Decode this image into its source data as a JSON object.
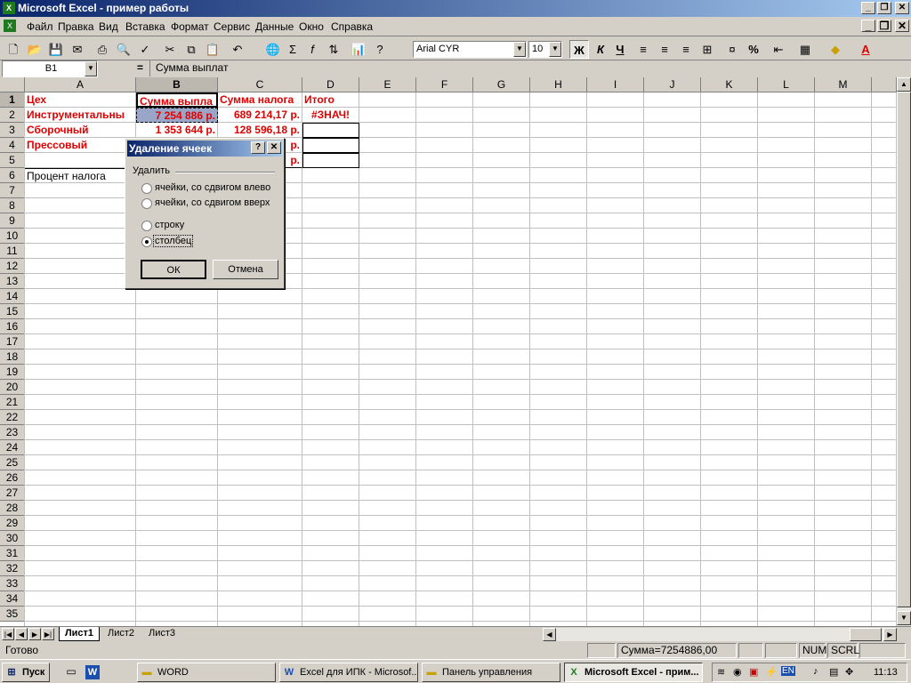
{
  "window": {
    "title": "Microsoft Excel - пример работы"
  },
  "menu": [
    "Файл",
    "Правка",
    "Вид",
    "Вставка",
    "Формат",
    "Сервис",
    "Данные",
    "Окно",
    "Справка"
  ],
  "toolbar": {
    "font": "Arial CYR",
    "size": "10",
    "bold": "Ж",
    "italic": "К",
    "underline": "Ч",
    "percent": "%"
  },
  "formula": {
    "namebox": "B1",
    "eq": "=",
    "content": "Сумма выплат"
  },
  "columns": [
    "A",
    "B",
    "C",
    "D",
    "E",
    "F",
    "G",
    "H",
    "I",
    "J",
    "K",
    "L",
    "M"
  ],
  "rows": [
    "1",
    "2",
    "3",
    "4",
    "5",
    "6",
    "7",
    "8",
    "9",
    "10",
    "11",
    "12",
    "13",
    "14",
    "15",
    "16",
    "17",
    "18",
    "19",
    "20",
    "21",
    "22",
    "23",
    "24",
    "25",
    "26",
    "27",
    "28",
    "29",
    "30",
    "31",
    "32",
    "33",
    "34",
    "35"
  ],
  "cells": {
    "a1": "Цех",
    "b1": "Сумма выпла",
    "c1": "Сумма налога",
    "d1": "Итого",
    "a2": "Инструментальны",
    "b2": "7 254 886 р.",
    "c2": "689 214,17 р.",
    "d2": "#ЗНАЧ!",
    "a3": "Сборочный",
    "b3": "1 353 644 р.",
    "c3": "128 596,18 р.",
    "a4": "Прессовый",
    "c4": "р.",
    "c5": "р.",
    "a6": "Процент налога"
  },
  "dialog": {
    "title": "Удаление ячеек",
    "group": "Удалить",
    "options": [
      "ячейки, со сдвигом влево",
      "ячейки, со сдвигом вверх",
      "строку",
      "столбец"
    ],
    "selected_index": 3,
    "ok": "ОК",
    "cancel": "Отмена"
  },
  "sheets": [
    "Лист1",
    "Лист2",
    "Лист3"
  ],
  "status": {
    "ready": "Готово",
    "sum": "Сумма=7254886,00",
    "num": "NUM",
    "scrl": "SCRL"
  },
  "taskbar": {
    "start": "Пуск",
    "tasks": [
      "WORD",
      "Excel для ИПК - Microsof...",
      "Панель управления",
      "Microsoft Excel - прим..."
    ],
    "lang": "EN",
    "clock": "11:13"
  },
  "colors": {
    "accent": "#0a246a",
    "data_red": "#e00000",
    "face": "#d4d0c8"
  }
}
